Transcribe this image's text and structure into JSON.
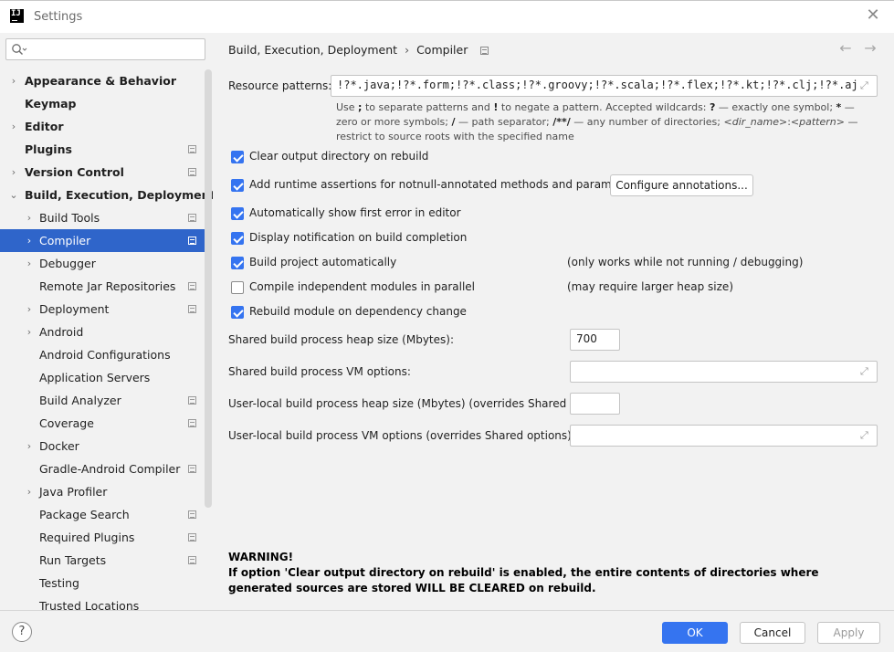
{
  "window": {
    "title": "Settings",
    "logo_text": "IJ"
  },
  "search": {
    "placeholder": "",
    "value": ""
  },
  "sidebar": {
    "items": [
      {
        "label": "Appearance & Behavior",
        "level": 0,
        "arrow": "›",
        "bold": true,
        "badge": false,
        "selected": false
      },
      {
        "label": "Keymap",
        "level": 0,
        "arrow": "",
        "bold": true,
        "badge": false,
        "selected": false
      },
      {
        "label": "Editor",
        "level": 0,
        "arrow": "›",
        "bold": true,
        "badge": false,
        "selected": false
      },
      {
        "label": "Plugins",
        "level": 0,
        "arrow": "",
        "bold": true,
        "badge": true,
        "selected": false
      },
      {
        "label": "Version Control",
        "level": 0,
        "arrow": "›",
        "bold": true,
        "badge": true,
        "selected": false
      },
      {
        "label": "Build, Execution, Deployment",
        "level": 0,
        "arrow": "⌄",
        "bold": true,
        "badge": false,
        "selected": false
      },
      {
        "label": "Build Tools",
        "level": 1,
        "arrow": "›",
        "bold": false,
        "badge": true,
        "selected": false
      },
      {
        "label": "Compiler",
        "level": 1,
        "arrow": "›",
        "bold": false,
        "badge": true,
        "selected": true
      },
      {
        "label": "Debugger",
        "level": 1,
        "arrow": "›",
        "bold": false,
        "badge": false,
        "selected": false
      },
      {
        "label": "Remote Jar Repositories",
        "level": 1,
        "arrow": "",
        "bold": false,
        "badge": true,
        "selected": false
      },
      {
        "label": "Deployment",
        "level": 1,
        "arrow": "›",
        "bold": false,
        "badge": true,
        "selected": false
      },
      {
        "label": "Android",
        "level": 1,
        "arrow": "›",
        "bold": false,
        "badge": false,
        "selected": false
      },
      {
        "label": "Android Configurations",
        "level": 1,
        "arrow": "",
        "bold": false,
        "badge": false,
        "selected": false
      },
      {
        "label": "Application Servers",
        "level": 1,
        "arrow": "",
        "bold": false,
        "badge": false,
        "selected": false
      },
      {
        "label": "Build Analyzer",
        "level": 1,
        "arrow": "",
        "bold": false,
        "badge": true,
        "selected": false
      },
      {
        "label": "Coverage",
        "level": 1,
        "arrow": "",
        "bold": false,
        "badge": true,
        "selected": false
      },
      {
        "label": "Docker",
        "level": 1,
        "arrow": "›",
        "bold": false,
        "badge": false,
        "selected": false
      },
      {
        "label": "Gradle-Android Compiler",
        "level": 1,
        "arrow": "",
        "bold": false,
        "badge": true,
        "selected": false
      },
      {
        "label": "Java Profiler",
        "level": 1,
        "arrow": "›",
        "bold": false,
        "badge": false,
        "selected": false
      },
      {
        "label": "Package Search",
        "level": 1,
        "arrow": "",
        "bold": false,
        "badge": true,
        "selected": false
      },
      {
        "label": "Required Plugins",
        "level": 1,
        "arrow": "",
        "bold": false,
        "badge": true,
        "selected": false
      },
      {
        "label": "Run Targets",
        "level": 1,
        "arrow": "",
        "bold": false,
        "badge": true,
        "selected": false
      },
      {
        "label": "Testing",
        "level": 1,
        "arrow": "",
        "bold": false,
        "badge": false,
        "selected": false
      },
      {
        "label": "Trusted Locations",
        "level": 1,
        "arrow": "",
        "bold": false,
        "badge": false,
        "selected": false
      }
    ]
  },
  "breadcrumb": {
    "parent": "Build, Execution, Deployment",
    "separator": "›",
    "current": "Compiler"
  },
  "resource_patterns": {
    "label": "Resource patterns:",
    "value": "!?*.java;!?*.form;!?*.class;!?*.groovy;!?*.scala;!?*.flex;!?*.kt;!?*.clj;!?*.aj"
  },
  "help": {
    "p1": "Use ",
    "k1": ";",
    "p2": " to separate patterns and ",
    "k2": "!",
    "p3": " to negate a pattern. Accepted wildcards: ",
    "k3": "?",
    "p4": " — exactly one symbol; ",
    "k4": "*",
    "p5": " — zero or more symbols; ",
    "k5": "/",
    "p6": " — path separator; ",
    "k6": "/**/",
    "p7": " — any number of directories; ",
    "i1": "<dir_name>",
    "p8": ":",
    "i2": "<pattern>",
    "p9": " — restrict to source roots with the specified name"
  },
  "options": {
    "clear_output": {
      "label": "Clear output directory on rebuild",
      "checked": true
    },
    "runtime_assertions": {
      "label": "Add runtime assertions for notnull-annotated methods and parameters",
      "checked": true
    },
    "configure_annotations": "Configure annotations...",
    "show_first_error": {
      "label": "Automatically show first error in editor",
      "checked": true
    },
    "display_notification": {
      "label": "Display notification on build completion",
      "checked": true
    },
    "build_automatically": {
      "label": "Build project automatically",
      "checked": true,
      "note": "(only works while not running / debugging)"
    },
    "compile_parallel": {
      "label": "Compile independent modules in parallel",
      "checked": false,
      "note": "(may require larger heap size)"
    },
    "rebuild_on_dependency": {
      "label": "Rebuild module on dependency change",
      "checked": true
    }
  },
  "fields": {
    "heap_size": {
      "label": "Shared build process heap size (Mbytes):",
      "value": "700"
    },
    "vm_options": {
      "label": "Shared build process VM options:",
      "value": ""
    },
    "local_heap": {
      "label": "User-local build process heap size (Mbytes) (overrides Shared size):",
      "value": ""
    },
    "local_vm": {
      "label": "User-local build process VM options (overrides Shared options):",
      "value": ""
    }
  },
  "warning": {
    "title": "WARNING!",
    "text": "If option 'Clear output directory on rebuild' is enabled, the entire contents of directories where generated sources are stored WILL BE CLEARED on rebuild."
  },
  "footer": {
    "help": "?",
    "ok": "OK",
    "cancel": "Cancel",
    "apply": "Apply"
  },
  "colors": {
    "accent": "#3574f0",
    "selection": "#2f65ca",
    "panel": "#f2f2f2"
  }
}
